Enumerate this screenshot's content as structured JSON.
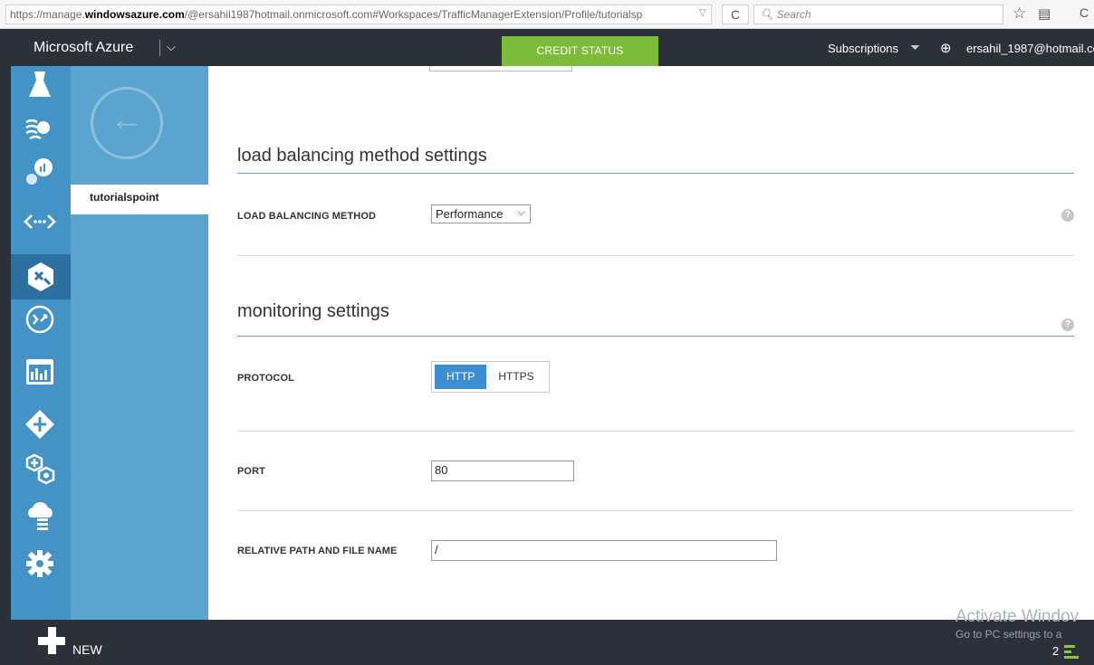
{
  "browser": {
    "url_prefix": "https://manage.",
    "url_domain": "windowsazure.com",
    "url_rest": "/@ersahil1987hotmail.onmicrosoft.com#Workspaces/TrafficManagerExtension/Profile/tutorialsp",
    "search_placeholder": "Search",
    "reload_icon": "C",
    "star_icon": "☆",
    "reader_icon": "▤",
    "extra_icon": "C"
  },
  "header": {
    "brand": "Microsoft Azure",
    "credit_status": "CREDIT STATUS",
    "subscriptions": "Subscriptions",
    "user": "ersahil_1987@hotmail.co",
    "chevron": "⌵",
    "filter_icon": "⏷",
    "globe_icon": "⊕"
  },
  "left_nav": {
    "icons": [
      "flask-icon",
      "gear-wave-icon",
      "analytics-icon",
      "code-arrows-icon",
      "traffic-manager-icon",
      "connection-icon",
      "dashboard-icon",
      "network-icon",
      "hexagon-add-icon",
      "cloud-service-icon",
      "settings-icon"
    ]
  },
  "sub_nav": {
    "selected": "tutorialspoint",
    "back_arrow": "←"
  },
  "main": {
    "lb_section_title": "load balancing method settings",
    "lb_method_label": "LOAD BALANCING METHOD",
    "lb_method_value": "Performance",
    "monitoring_section_title": "monitoring settings",
    "protocol_label": "PROTOCOL",
    "protocol_options": [
      "HTTP",
      "HTTPS"
    ],
    "protocol_selected": "HTTP",
    "port_label": "PORT",
    "port_value": "80",
    "path_label": "RELATIVE PATH AND FILE NAME",
    "path_value": "/",
    "help_glyph": "?"
  },
  "bottom": {
    "new_label": "NEW",
    "activate_line1": "Activate Windov",
    "activate_line2": "Go to PC settings to a",
    "count": "2"
  }
}
